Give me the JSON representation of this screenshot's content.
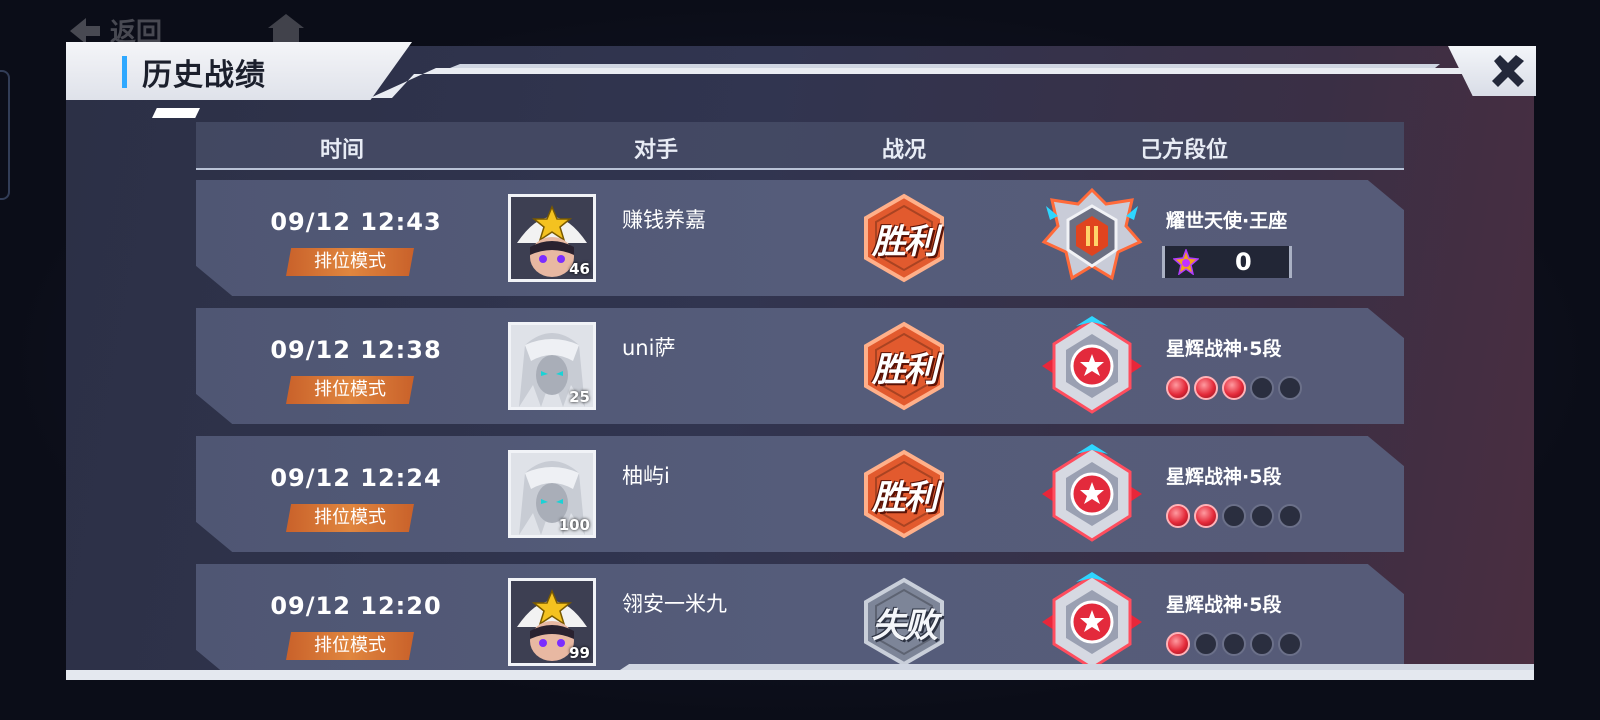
{
  "nav": {
    "back_label": "返回"
  },
  "page": {
    "title": "历史战绩"
  },
  "columns": [
    "时间",
    "对手",
    "战况",
    "己方段位"
  ],
  "matches": [
    {
      "time": "09/12 12:43",
      "mode": "排位模式",
      "opponent": "赚钱养嘉",
      "opponent_avatar": "star-hat-avatar",
      "level": "46",
      "result": "胜利",
      "result_kind": "win",
      "rank_name": "耀世天使·王座",
      "rank_points": "0"
    },
    {
      "time": "09/12 12:38",
      "mode": "排位模式",
      "opponent": "uni萨",
      "opponent_avatar": "white-hair-avatar",
      "level": "25",
      "result": "胜利",
      "result_kind": "win",
      "rank_name": "星辉战神·5段",
      "stars_filled": 3,
      "stars_total": 5
    },
    {
      "time": "09/12 12:24",
      "mode": "排位模式",
      "opponent": "柚屿i",
      "opponent_avatar": "white-hair-avatar",
      "level": "100",
      "result": "胜利",
      "result_kind": "win",
      "rank_name": "星辉战神·5段",
      "stars_filled": 2,
      "stars_total": 5
    },
    {
      "time": "09/12 12:20",
      "mode": "排位模式",
      "opponent": "翎安一米九",
      "opponent_avatar": "star-hat-avatar",
      "level": "99",
      "result": "失败",
      "result_kind": "lose",
      "rank_name": "星辉战神·5段",
      "stars_filled": 1,
      "stars_total": 5
    }
  ],
  "colors": {
    "accent_blue": "#2ea8ff",
    "mode_badge": "#e0863f",
    "win_badge": "#e25a2e",
    "lose_badge": "#7d8598",
    "star_filled": "#e42a3a"
  }
}
